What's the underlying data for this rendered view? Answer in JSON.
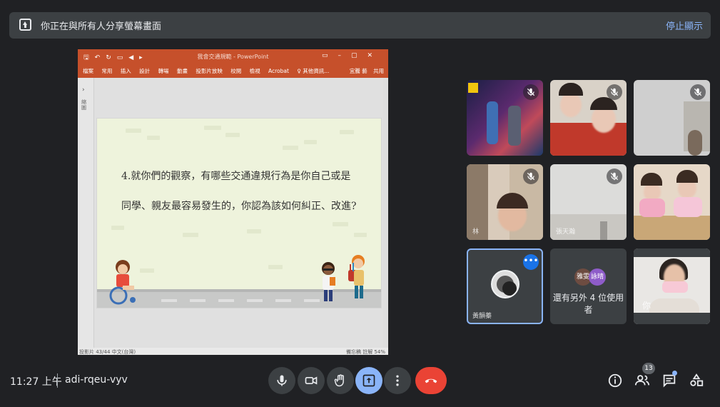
{
  "banner": {
    "text": "你正在與所有人分享螢幕畫面",
    "stop_label": "停止顯示"
  },
  "ppt": {
    "title": "我會交通規範 - PowerPoint",
    "tabs": [
      "檔案",
      "常用",
      "插入",
      "設計",
      "轉場",
      "動畫",
      "投影片放映",
      "校閱",
      "檢視",
      "Acrobat",
      "♀ 其他資訊..."
    ],
    "right_items": [
      "宜騰 藝",
      "共用"
    ],
    "thumb_label": "縮圖",
    "slide_lines": [
      "4.就你們的觀察，有哪些交通違規行為是你自己或是",
      "同學、親友最容易發生的，你認為該如何糾正、改進?"
    ],
    "status_left": "投影片 43/44   中文(台灣)",
    "status_right": "備忘稿   註解   54%"
  },
  "tiles": {
    "p6_name": "",
    "p4_name": "林",
    "p5_name": "張天瀚",
    "p7_name": "黃韻蓁",
    "others_avatars": [
      "雅雯",
      "詠晴"
    ],
    "others_text": "還有另外 4 位使用者",
    "self_name": "你"
  },
  "bottom": {
    "time": "11:27 上午",
    "meeting_code": "adi-rqeu-vyv",
    "participants_count": "13"
  },
  "colors": {
    "accent": "#8ab4f8",
    "end_call": "#ea4335",
    "ppt": "#c6502b"
  }
}
